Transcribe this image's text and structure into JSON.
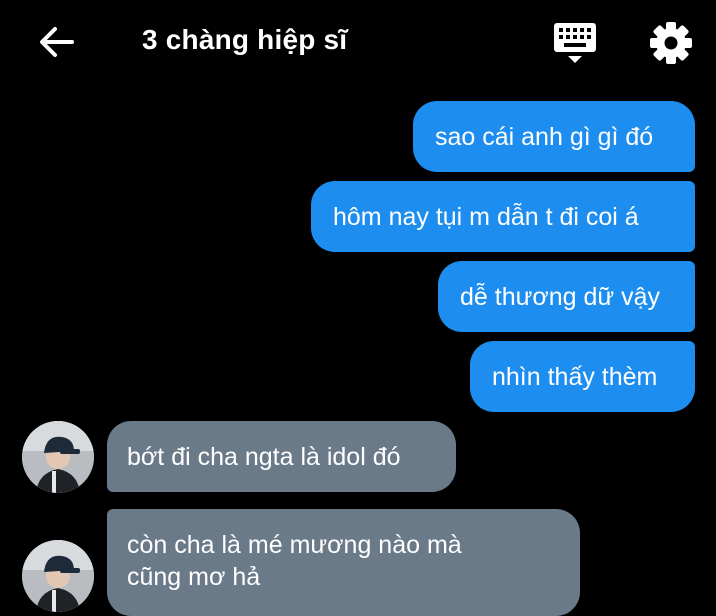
{
  "header": {
    "title": "3 chàng hiệp sĩ",
    "back_icon": "arrow-left-icon",
    "keyboard_icon": "keyboard-icon",
    "settings_icon": "gear-icon"
  },
  "colors": {
    "background": "#000000",
    "outgoing_bubble": "#1d8ef0",
    "incoming_bubble": "#6b7a89",
    "text": "#ffffff"
  },
  "messages": {
    "outgoing": [
      "sao cái anh gì gì đó",
      "hôm nay tụi m dẫn t đi coi á",
      "dễ thương dữ vậy",
      "nhìn thấy thèm"
    ],
    "incoming": [
      {
        "text": "bớt đi cha ngta là idol đó"
      },
      {
        "line1": "còn cha là mé mương nào mà",
        "line2": "cũng mơ hả"
      }
    ]
  }
}
